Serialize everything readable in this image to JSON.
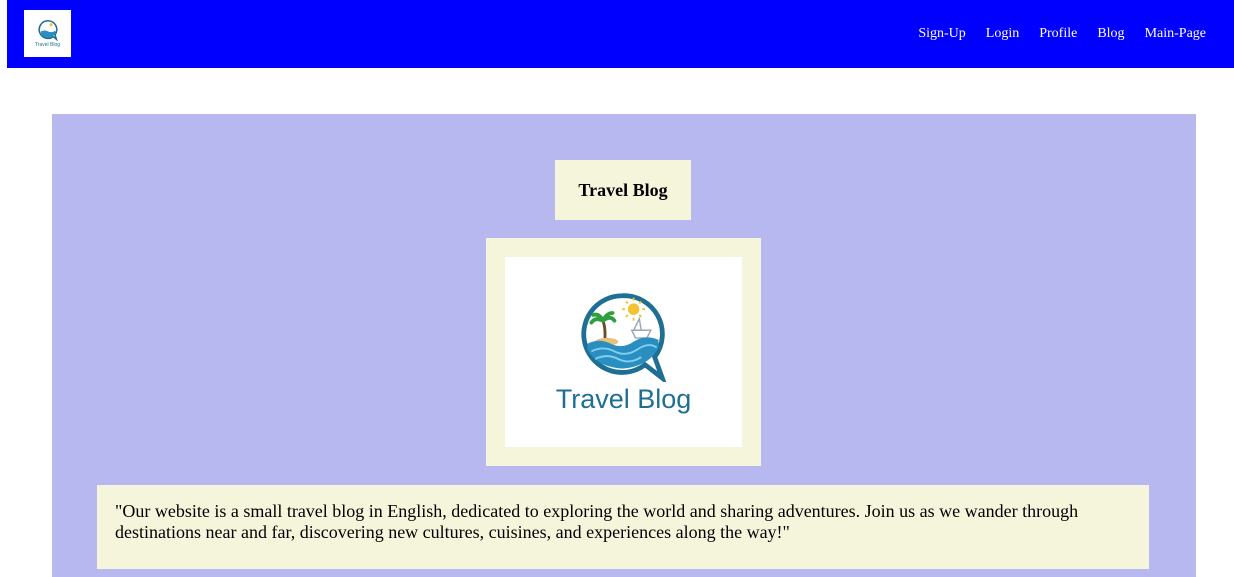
{
  "nav": {
    "logo_text": "Travel Blog",
    "links": [
      "Sign-Up",
      "Login",
      "Profile",
      "Blog",
      "Main-Page"
    ]
  },
  "main": {
    "title": "Travel Blog",
    "image_text": "Travel Blog",
    "description": "\"Our website is a small travel blog in English, dedicated to exploring the world and sharing adventures. Join us as we wander through destinations near and far, discovering new cultures, cuisines, and experiences along the way!\""
  },
  "colors": {
    "navbar": "#0000ff",
    "panel": "#b8b8f0",
    "box": "#f5f5dc",
    "logo_blue": "#1f6f95"
  },
  "icons": [
    "travel-blog-logo-icon"
  ]
}
